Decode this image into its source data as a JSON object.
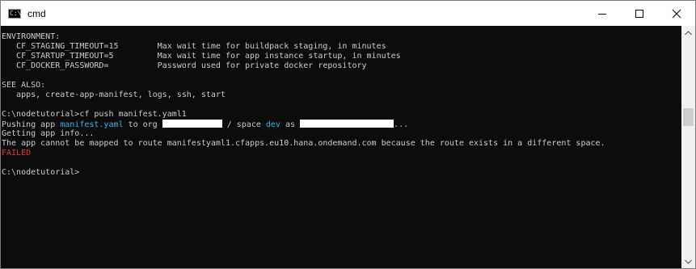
{
  "window": {
    "title": "cmd",
    "app_icon_glyph": "C:\\",
    "icons": [
      "cmd-icon",
      "minimize-icon",
      "maximize-icon",
      "close-icon",
      "scroll-up-icon",
      "scroll-down-icon"
    ]
  },
  "colors": {
    "console_bg": "#0c0c0c",
    "text": "#cccccc",
    "highlight_cyan": "#3ab4e6",
    "error_red": "#e23b3b"
  },
  "console": {
    "env_header": "ENVIRONMENT:",
    "env_vars": [
      {
        "name": "   CF_STAGING_TIMEOUT=15        ",
        "desc": "Max wait time for buildpack staging, in minutes"
      },
      {
        "name": "   CF_STARTUP_TIMEOUT=5         ",
        "desc": "Max wait time for app instance startup, in minutes"
      },
      {
        "name": "   CF_DOCKER_PASSWORD=          ",
        "desc": "Password used for private docker repository"
      }
    ],
    "see_also_header": "SEE ALSO:",
    "see_also_list": "   apps, create-app-manifest, logs, ssh, start",
    "prompt_command": "C:\\nodetutorial>cf push manifest.yaml1",
    "push": {
      "prefix": "Pushing app ",
      "app": "manifest.yaml",
      "to_org": " to org ",
      "space_label": " / space ",
      "space": "dev",
      "as_label": " as ",
      "ellipsis": "..."
    },
    "getting_info": "Getting app info...",
    "error_message": "The app cannot be mapped to route manifestyaml1.cfapps.eu10.hana.ondemand.com because the route exists in a different space.",
    "failed": "FAILED",
    "prompt_final": "C:\\nodetutorial>"
  }
}
